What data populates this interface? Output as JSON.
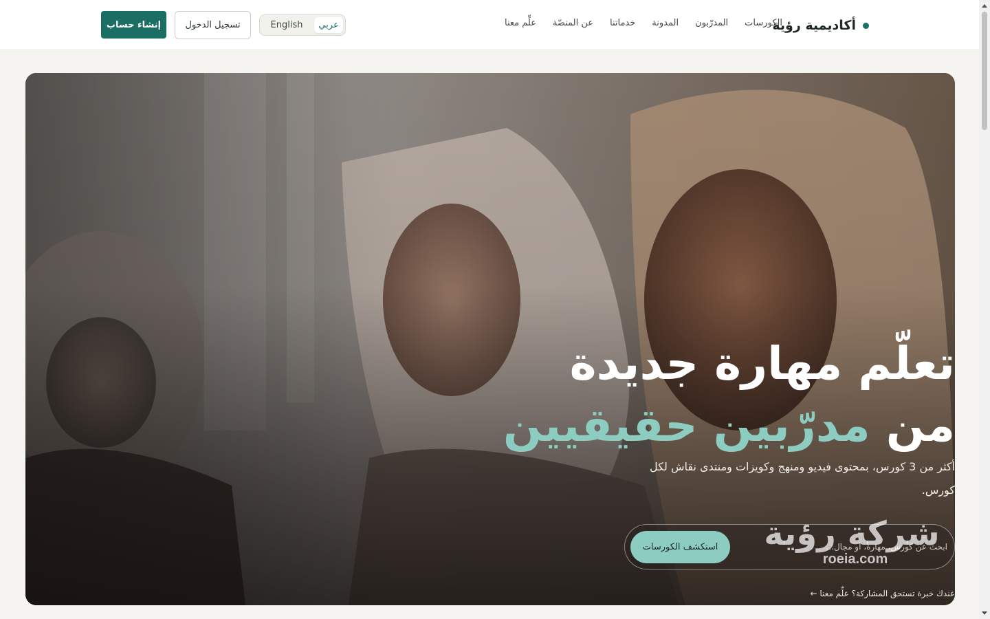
{
  "header": {
    "brand": "أكاديمية رؤية",
    "nav": [
      "الكورسات",
      "المدرّبون",
      "المدونة",
      "خدماتنا",
      "عن المنصّة",
      "علِّم معنا"
    ],
    "lang": {
      "active": "عربي",
      "other": "English"
    },
    "login_label": "تسجيل الدخول",
    "signup_label": "إنشاء حساب"
  },
  "hero": {
    "title_line1": "تعلّم مهارة جديدة",
    "title_line2_prefix": "من",
    "title_line2_accent": "مدرّبين حقيقيين",
    "subtitle": "أكثر من 3 كورس، بمحتوى فيديو ومنهج وكويزات ومنتدى نقاش لكل كورس.",
    "search_placeholder": "ابحث عن كورس، مهارة، أو مجال...",
    "explore_label": "استكشف الكورسات",
    "teach_link": "عندك خبرة تستحق المشاركة؟ علِّم معنا ←",
    "watermark_ar": "شركة رؤية",
    "watermark_en": "roeia.com"
  },
  "colors": {
    "brand": "#1b6e63",
    "accent": "#8cccc1"
  }
}
